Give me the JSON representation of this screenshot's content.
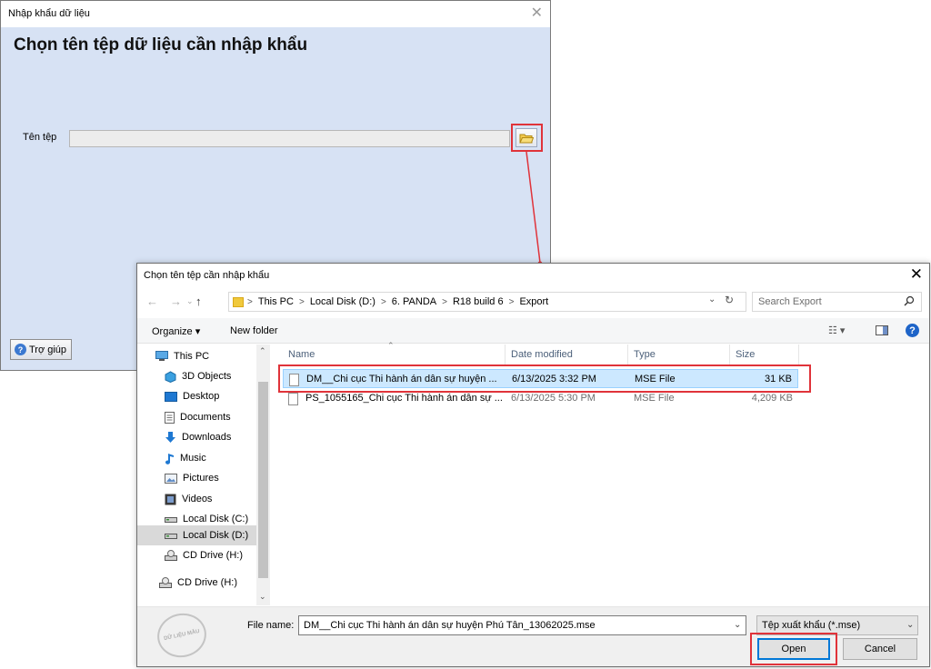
{
  "import_window": {
    "title": "Nhập khẩu dữ liệu",
    "close_glyph": "✕",
    "heading": "Chọn tên tệp dữ liệu cần nhập khẩu",
    "file_label": "Tên tệp",
    "file_value": "",
    "help_label": "Trợ giúp",
    "help_glyph": "?"
  },
  "open_dialog": {
    "title": "Chọn tên tệp cần nhập khẩu",
    "close_glyph": "✕",
    "nav": {
      "back": "←",
      "forward": "→",
      "up": "↑"
    },
    "address": [
      "This PC",
      "Local Disk (D:)",
      "6. PANDA",
      "R18 build 6",
      "Export"
    ],
    "address_sep": ">",
    "search_placeholder": "Search Export",
    "toolbar": {
      "organize": "Organize ▾",
      "new_folder": "New folder",
      "view": "☷ ▾",
      "help": "?"
    },
    "nav_items": [
      {
        "label": "This PC",
        "icon": "pc-icon"
      },
      {
        "label": "3D Objects",
        "icon": "cube-icon"
      },
      {
        "label": "Desktop",
        "icon": "desktop-icon"
      },
      {
        "label": "Documents",
        "icon": "document-icon"
      },
      {
        "label": "Downloads",
        "icon": "download-icon"
      },
      {
        "label": "Music",
        "icon": "music-icon"
      },
      {
        "label": "Pictures",
        "icon": "picture-icon"
      },
      {
        "label": "Videos",
        "icon": "video-icon"
      },
      {
        "label": "Local Disk (C:)",
        "icon": "drive-icon"
      },
      {
        "label": "Local Disk (D:)",
        "icon": "drive-icon"
      },
      {
        "label": "CD Drive (H:)",
        "icon": "cd-icon"
      },
      {
        "label": "CD Drive (H:)",
        "icon": "cd-icon"
      }
    ],
    "columns": {
      "name": "Name",
      "date": "Date modified",
      "type": "Type",
      "size": "Size"
    },
    "files": [
      {
        "name": "DM__Chi cục Thi hành án dân sự huyện ...",
        "date": "6/13/2025 3:32 PM",
        "type": "MSE File",
        "size": "31 KB"
      },
      {
        "name": "PS_1055165_Chi cục Thi hành án dân sự ...",
        "date": "6/13/2025 5:30 PM",
        "type": "MSE File",
        "size": "4,209 KB"
      }
    ],
    "file_name_label": "File name:",
    "file_name_value": "DM__Chi cục Thi hành án dân sự huyện Phú Tân_13062025.mse",
    "filter": "Tệp xuất khẩu (*.mse)",
    "open_label": "Open",
    "cancel_label": "Cancel",
    "stamp_text": "DỮ LIỆU MẪU"
  },
  "colors": {
    "highlight": "#e0333a",
    "window_bg": "#d7e2f4",
    "selection": "#cce8ff"
  }
}
